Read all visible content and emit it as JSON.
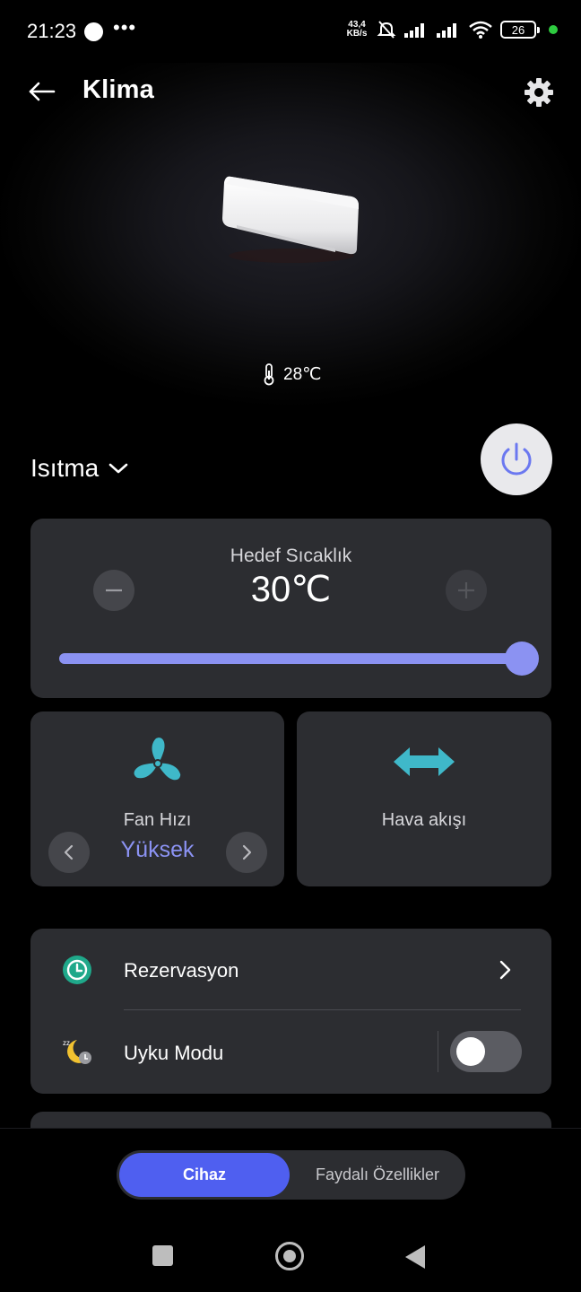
{
  "status_bar": {
    "time": "21:23",
    "net_speed_value": "43,4",
    "net_speed_unit": "KB/s",
    "battery": "26"
  },
  "header": {
    "title": "Klima",
    "back_icon": "arrow-left-icon",
    "settings_icon": "gear-icon"
  },
  "device": {
    "current_temperature": "28℃",
    "temperature_icon": "thermometer-icon"
  },
  "mode": {
    "label": "Isıtma",
    "power_icon": "power-icon"
  },
  "target_temperature": {
    "title": "Hedef Sıcaklık",
    "value": "30℃",
    "slider_level": 1.0
  },
  "fan": {
    "label": "Fan Hızı",
    "value": "Yüksek",
    "icon": "fan-icon"
  },
  "airflow": {
    "label": "Hava akışı",
    "icon": "horizontal-swing-icon"
  },
  "features": [
    {
      "label": "Rezervasyon",
      "icon": "clock-schedule-icon"
    },
    {
      "label": "Uyku Modu",
      "icon": "sleep-moon-icon",
      "enabled": false
    }
  ],
  "bottom_tabs": {
    "active": "Cihaz",
    "other": "Faydalı Özellikler"
  },
  "colors": {
    "accent": "#8b92f2",
    "tab_active": "#4f5ff0",
    "card": "#2c2d31",
    "icon_cyan": "#3fb8c9"
  }
}
